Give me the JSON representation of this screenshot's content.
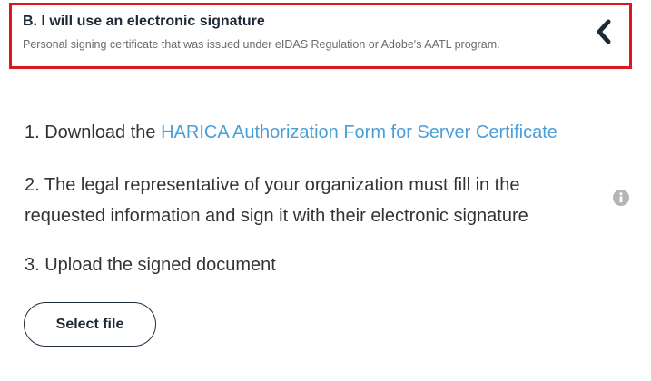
{
  "option": {
    "title": "B. I will use an electronic signature",
    "description": "Personal signing certificate that was issued under eIDAS Regulation or Adobe's AATL program.",
    "border_color": "#e0161e",
    "toggle_icon": "chevron-left-icon"
  },
  "steps": {
    "step1_prefix": "1. Download the ",
    "step1_link": "HARICA Authorization Form for Server Certificate",
    "step2": "2. The legal representative of your organization must fill in the requested information and sign it with their electronic signature",
    "step3": "3. Upload the signed document",
    "info_icon": "info-icon"
  },
  "actions": {
    "select_file_label": "Select file"
  },
  "colors": {
    "link": "#4a9fd8",
    "text": "#333333",
    "icon_gray": "#b5b5b5",
    "button_border": "#1f2d3d"
  }
}
